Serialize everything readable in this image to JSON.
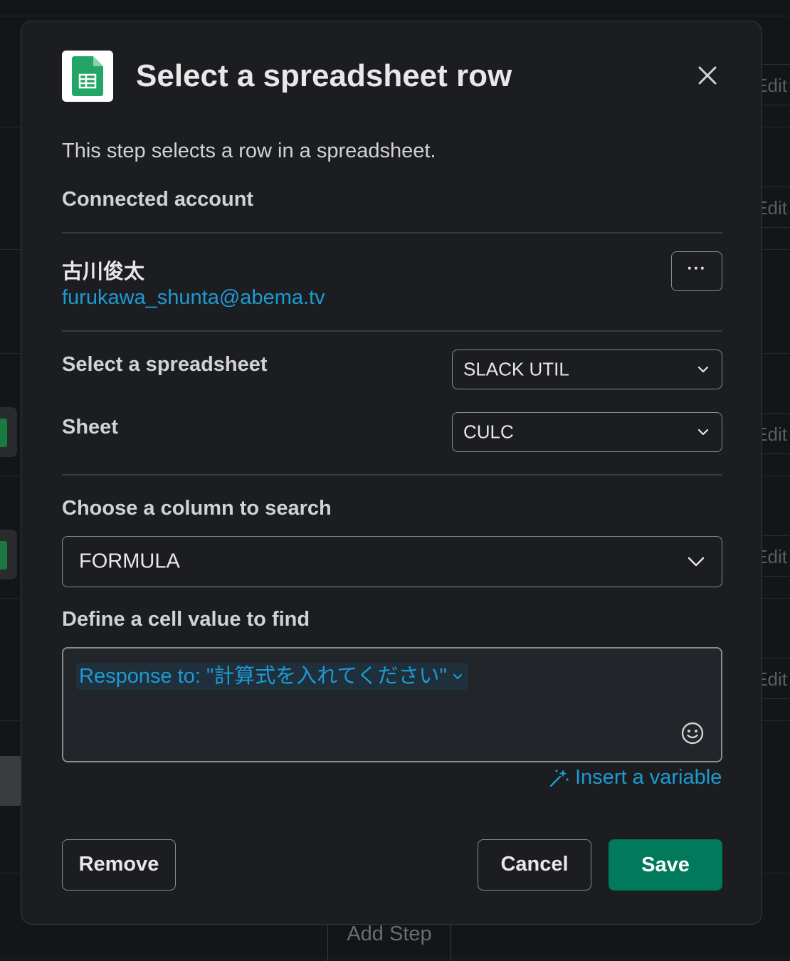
{
  "background": {
    "edit_label": "Edit",
    "add_step_label": "Add Step"
  },
  "modal": {
    "title": "Select a spreadsheet row",
    "description": "This step selects a row in a spreadsheet.",
    "connected_account_label": "Connected account",
    "account": {
      "name": "古川俊太",
      "email": "furukawa_shunta@abema.tv",
      "more_label": "···"
    },
    "spreadsheet": {
      "label": "Select a spreadsheet",
      "value": "SLACK UTIL"
    },
    "sheet": {
      "label": "Sheet",
      "value": "CULC"
    },
    "column": {
      "label": "Choose a column to search",
      "value": "FORMULA"
    },
    "cell_value": {
      "label": "Define a cell value to find",
      "token": "Response to: \"計算式を入れてください\""
    },
    "insert_variable_label": "Insert a variable",
    "buttons": {
      "remove": "Remove",
      "cancel": "Cancel",
      "save": "Save"
    },
    "colors": {
      "accent_link": "#1d9bd1",
      "save_green": "#007a5a",
      "sheets_green": "#23a566"
    }
  }
}
